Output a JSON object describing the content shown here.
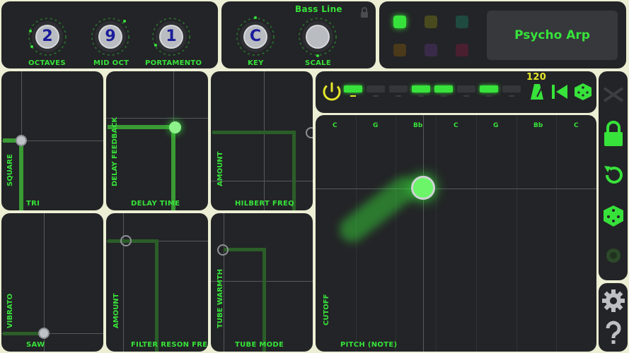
{
  "knobs": {
    "octaves": {
      "value": "2",
      "label": "OCTAVES"
    },
    "mid_oct": {
      "value": "9",
      "label": "MID OCT"
    },
    "portamento": {
      "value": "1",
      "label": "PORTAMENTO"
    },
    "key": {
      "value": "C",
      "label": "KEY"
    },
    "scale": {
      "label": "SCALE"
    }
  },
  "preset_category": "Bass Line",
  "preset_name": "Psycho Arp",
  "tempo": "120",
  "pads": [
    {
      "x_label": "TRI",
      "y_label": "SQUARE"
    },
    {
      "x_label": "DELAY TIME",
      "y_label": "DELAY FEEDBACK"
    },
    {
      "x_label": "HILBERT FREQ",
      "y_label": "AMOUNT"
    },
    {
      "x_label": "SAW",
      "y_label": "VIBRATO"
    },
    {
      "x_label": "FILTER RESON FREQ",
      "y_label": "AMOUNT"
    },
    {
      "x_label": "TUBE MODE",
      "y_label": "TUBE WARMTH"
    }
  ],
  "main_pad": {
    "x_label": "PITCH (NOTE)",
    "y_label": "CUTOFF",
    "notes": [
      "C",
      "G",
      "Bb",
      "C",
      "G",
      "Bb",
      "C"
    ]
  },
  "sequencer_steps": [
    1,
    0,
    0,
    1,
    1,
    0,
    1,
    0
  ],
  "colors": {
    "accent": "#37e23a",
    "panel": "#232427",
    "background": "#ecefd4",
    "yellow": "#e6e62a",
    "swatches": [
      "#37e23a",
      "#4a4a1f",
      "#1f4a40",
      "#4a3a1a",
      "#3a2a4a",
      "#4a1f2f"
    ]
  },
  "icons": [
    "lock-icon",
    "power-icon",
    "metronome-icon",
    "rewind-icon",
    "dice-icon",
    "shuffle-icon",
    "undo-icon",
    "record-icon",
    "gear-icon",
    "help-icon"
  ]
}
